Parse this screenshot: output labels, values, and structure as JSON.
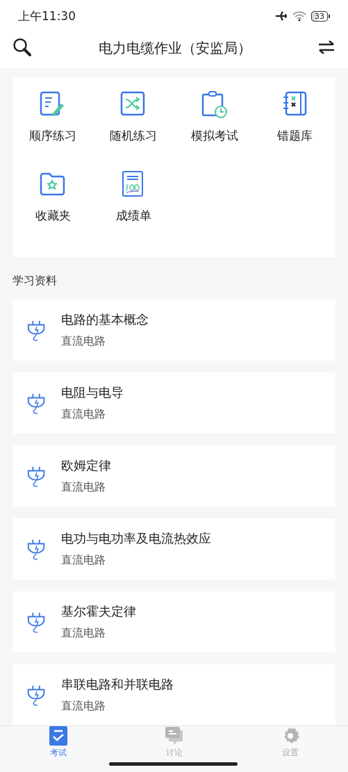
{
  "status_bar": {
    "time": "上午11:30",
    "battery": "33"
  },
  "header": {
    "title": "电力电缆作业（安监局）"
  },
  "menu": [
    {
      "label": "顺序练习",
      "kind": "edit"
    },
    {
      "label": "随机练习",
      "kind": "shuffle"
    },
    {
      "label": "模拟考试",
      "kind": "exam"
    },
    {
      "label": "错题库",
      "kind": "wrong"
    },
    {
      "label": "收藏夹",
      "kind": "favorite"
    },
    {
      "label": "成绩单",
      "kind": "score"
    }
  ],
  "section_title": "学习资料",
  "materials": [
    {
      "title": "电路的基本概念",
      "subtitle": "直流电路"
    },
    {
      "title": "电阻与电导",
      "subtitle": "直流电路"
    },
    {
      "title": "欧姆定律",
      "subtitle": "直流电路"
    },
    {
      "title": "电功与电功率及电流热效应",
      "subtitle": "直流电路"
    },
    {
      "title": "基尔霍夫定律",
      "subtitle": "直流电路"
    },
    {
      "title": "串联电路和并联电路",
      "subtitle": "直流电路"
    }
  ],
  "tab_bar": [
    {
      "label": "考试",
      "kind": "exam",
      "selected": true
    },
    {
      "label": "讨论",
      "kind": "chat",
      "selected": false
    },
    {
      "label": "设置",
      "kind": "settings",
      "selected": false
    }
  ]
}
